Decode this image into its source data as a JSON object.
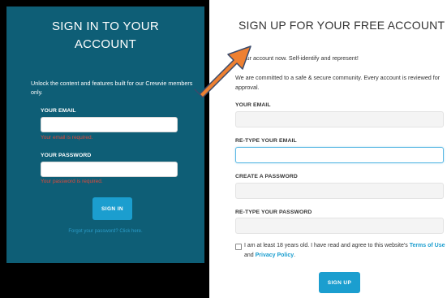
{
  "signin": {
    "title_line1": "SIGN IN TO YOUR",
    "title_line2": "ACCOUNT",
    "intro": "Unlock the content and features built for our Crewvie members only.",
    "email_label": "YOUR EMAIL",
    "email_value": "",
    "email_error": "Your email is required.",
    "password_label": "YOUR PASSWORD",
    "password_value": "",
    "password_error": "Your password is required.",
    "button_label": "SIGN IN",
    "forgot_link": "Forgot your password? Click here."
  },
  "signup": {
    "title": "SIGN UP FOR YOUR FREE ACCOUNT",
    "intro1": "e your account now. Self-identify and represent!",
    "intro2": "We are committed to a safe & secure community. Every account is reviewed for approval.",
    "email_label": "YOUR EMAIL",
    "retype_email_label": "RE-TYPE YOUR EMAIL",
    "password_label": "CREATE A PASSWORD",
    "retype_password_label": "RE-TYPE YOUR PASSWORD",
    "agree_text_1": "I am at least 18 years old. I have read and agree to this website's",
    "terms_link": "Terms of Use",
    "agree_and": " and ",
    "privacy_link": "Privacy Policy",
    "agree_end": ".",
    "button_label": "SIGN UP"
  },
  "colors": {
    "left_panel_bg": "#0e5e76",
    "button_blue": "#1b9ecf",
    "error_red": "#e04a3b",
    "arrow_orange": "#ee8031"
  },
  "annotation": {
    "icon": "arrow-icon"
  }
}
